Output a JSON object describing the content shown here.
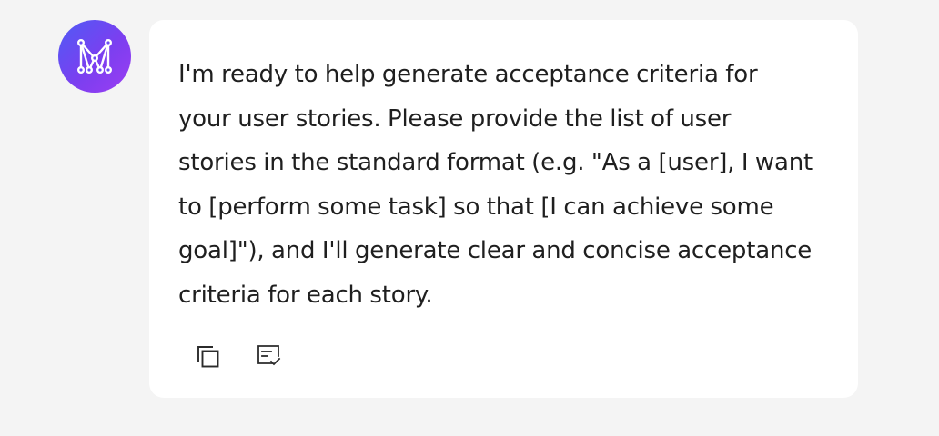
{
  "message": {
    "text": "I'm ready to help generate acceptance criteria for your user stories. Please provide the list of user stories in the standard format (e.g. \"As a [user], I want to [perform some task] so that [I can achieve some goal]\"), and I'll generate clear and concise acceptance criteria for each story."
  },
  "avatar": {
    "icon": "logo-m-network-icon",
    "gradient_start": "#4f5bf5",
    "gradient_end": "#9b3df2"
  },
  "actions": [
    {
      "icon": "copy-icon"
    },
    {
      "icon": "feedback-checklist-icon"
    }
  ]
}
